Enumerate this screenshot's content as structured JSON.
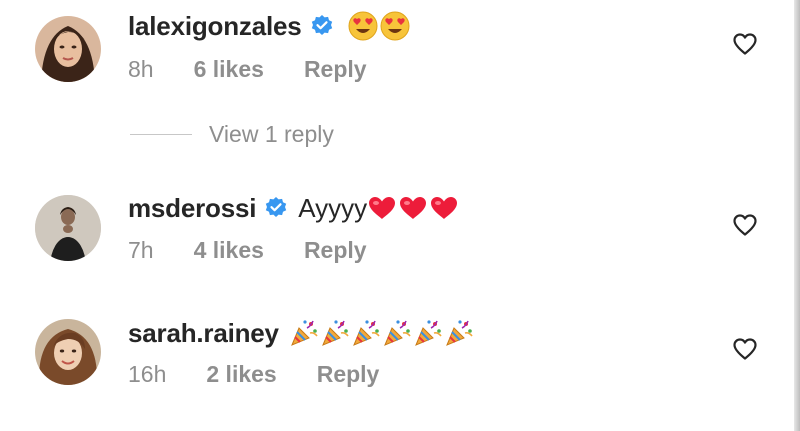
{
  "comments": [
    {
      "username": "lalexigonzales",
      "verified": true,
      "text": "",
      "emojis": [
        "smiling-face-with-heart-eyes",
        "smiling-face-with-heart-eyes"
      ],
      "time": "8h",
      "likes": "6 likes",
      "reply_label": "Reply",
      "view_replies": "View 1 reply"
    },
    {
      "username": "msderossi",
      "verified": true,
      "text": "Ayyyy",
      "emojis": [
        "red-heart",
        "red-heart",
        "red-heart"
      ],
      "time": "7h",
      "likes": "4 likes",
      "reply_label": "Reply"
    },
    {
      "username": "sarah.rainey",
      "verified": false,
      "text": "",
      "emojis": [
        "party-popper",
        "party-popper",
        "party-popper",
        "party-popper",
        "party-popper",
        "party-popper"
      ],
      "time": "16h",
      "likes": "2 likes",
      "reply_label": "Reply"
    }
  ],
  "colors": {
    "text": "#262626",
    "meta": "#8e8e8e",
    "verified_blue": "#3897f0",
    "heart_red": "#ed1c3a"
  }
}
